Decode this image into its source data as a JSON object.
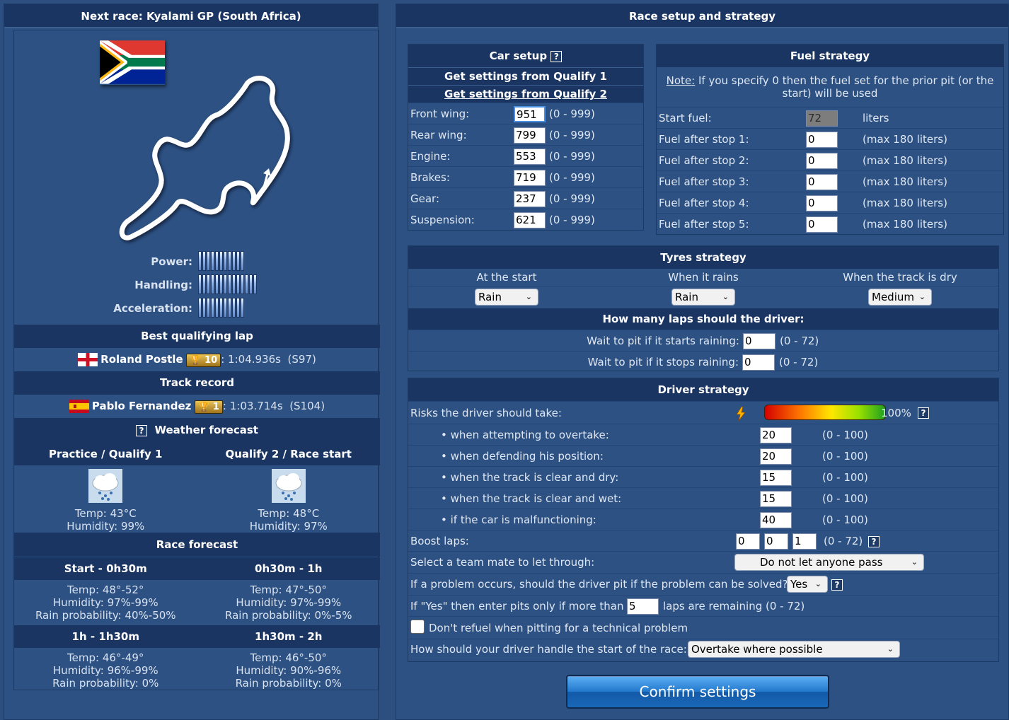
{
  "left": {
    "title": "Next race: Kyalami GP (South Africa)",
    "stats": [
      {
        "label": "Power:",
        "bars": 11
      },
      {
        "label": "Handling:",
        "bars": 14
      },
      {
        "label": "Acceleration:",
        "bars": 11
      }
    ],
    "best_lap": {
      "header": "Best qualifying lap",
      "driver": "Roland Postle",
      "trophies": "10",
      "time": ": 1:04.936s",
      "season": "(S97)"
    },
    "track_record": {
      "header": "Track record",
      "driver": "Pablo Fernandez",
      "trophies": "1",
      "time": ": 1:03.714s",
      "season": "(S104)"
    },
    "weather": {
      "header": "Weather forecast",
      "help": "?",
      "cols": [
        {
          "title": "Practice / Qualify 1",
          "temp": "Temp: 43°C",
          "humidity": "Humidity: 99%"
        },
        {
          "title": "Qualify 2 / Race start",
          "temp": "Temp: 48°C",
          "humidity": "Humidity: 97%"
        }
      ]
    },
    "race_forecast": {
      "header": "Race forecast",
      "periods": [
        {
          "title": "Start - 0h30m",
          "temp": "Temp: 48°-52°",
          "humidity": "Humidity: 97%-99%",
          "rain": "Rain probability: 40%-50%"
        },
        {
          "title": "0h30m - 1h",
          "temp": "Temp: 47°-50°",
          "humidity": "Humidity: 97%-99%",
          "rain": "Rain probability: 0%-5%"
        },
        {
          "title": "1h - 1h30m",
          "temp": "Temp: 46°-49°",
          "humidity": "Humidity: 96%-99%",
          "rain": "Rain probability: 0%"
        },
        {
          "title": "1h30m - 2h",
          "temp": "Temp: 46°-50°",
          "humidity": "Humidity: 90%-96%",
          "rain": "Rain probability: 0%"
        }
      ]
    }
  },
  "right": {
    "title": "Race setup and strategy",
    "car_setup": {
      "header": "Car setup",
      "help": "?",
      "q1": "Get settings from Qualify 1",
      "q2": "Get settings from Qualify 2",
      "rows": [
        {
          "label": "Front wing:",
          "value": "951",
          "range": "(0 - 999)"
        },
        {
          "label": "Rear wing:",
          "value": "799",
          "range": "(0 - 999)"
        },
        {
          "label": "Engine:",
          "value": "553",
          "range": "(0 - 999)"
        },
        {
          "label": "Brakes:",
          "value": "719",
          "range": "(0 - 999)"
        },
        {
          "label": "Gear:",
          "value": "237",
          "range": "(0 - 999)"
        },
        {
          "label": "Suspension:",
          "value": "621",
          "range": "(0 - 999)"
        }
      ]
    },
    "fuel": {
      "header": "Fuel strategy",
      "note_label": "Note:",
      "note": " If you specify 0 then the fuel set for the prior pit (or the start) will be used",
      "rows": [
        {
          "label": "Start fuel:",
          "value": "72",
          "unit": "liters"
        },
        {
          "label": "Fuel after stop 1:",
          "value": "0",
          "unit": "(max 180 liters)"
        },
        {
          "label": "Fuel after stop 2:",
          "value": "0",
          "unit": "(max 180 liters)"
        },
        {
          "label": "Fuel after stop 3:",
          "value": "0",
          "unit": "(max 180 liters)"
        },
        {
          "label": "Fuel after stop 4:",
          "value": "0",
          "unit": "(max 180 liters)"
        },
        {
          "label": "Fuel after stop 5:",
          "value": "0",
          "unit": "(max 180 liters)"
        }
      ]
    },
    "tyres": {
      "header": "Tyres strategy",
      "cols": [
        {
          "label": "At the start",
          "value": "Rain"
        },
        {
          "label": "When it rains",
          "value": "Rain"
        },
        {
          "label": "When the track is dry",
          "value": "Medium"
        }
      ],
      "laps_header": "How many laps should the driver:",
      "wait_rain": {
        "label": "Wait to pit if it starts raining:",
        "value": "0",
        "range": "(0 - 72)"
      },
      "wait_stop": {
        "label": "Wait to pit if it stops raining:",
        "value": "0",
        "range": "(0 - 72)"
      }
    },
    "driver": {
      "header": "Driver strategy",
      "risk_label": "Risks the driver should take:",
      "risk_pct": "100%",
      "risk_level": 1.0,
      "risk_rows": [
        {
          "label": "• when attempting to overtake:",
          "value": "20",
          "range": "(0 - 100)"
        },
        {
          "label": "• when defending his position:",
          "value": "20",
          "range": "(0 - 100)"
        },
        {
          "label": "• when the track is clear and dry:",
          "value": "15",
          "range": "(0 - 100)"
        },
        {
          "label": "• when the track is clear and wet:",
          "value": "15",
          "range": "(0 - 100)"
        },
        {
          "label": "• if the car is malfunctioning:",
          "value": "40",
          "range": "(0 - 100)"
        }
      ],
      "boost_label": "Boost laps:",
      "boost_values": [
        "0",
        "0",
        "1"
      ],
      "boost_range": "(0 - 72)",
      "teammate_label": "Select a team mate to let through:",
      "teammate_value": "Do not let anyone pass",
      "problem_label": "If a problem occurs, should the driver pit if the problem can be solved?",
      "problem_value": "Yes",
      "yes_label_a": "If \"Yes\" then enter pits only if more than",
      "yes_value": "5",
      "yes_label_b": "laps are remaining (0 - 72)",
      "refuel_label": "Don't refuel when pitting for a technical problem",
      "start_label": "How should your driver handle the start of the race:",
      "start_value": "Overtake where possible"
    },
    "confirm": "Confirm settings"
  }
}
